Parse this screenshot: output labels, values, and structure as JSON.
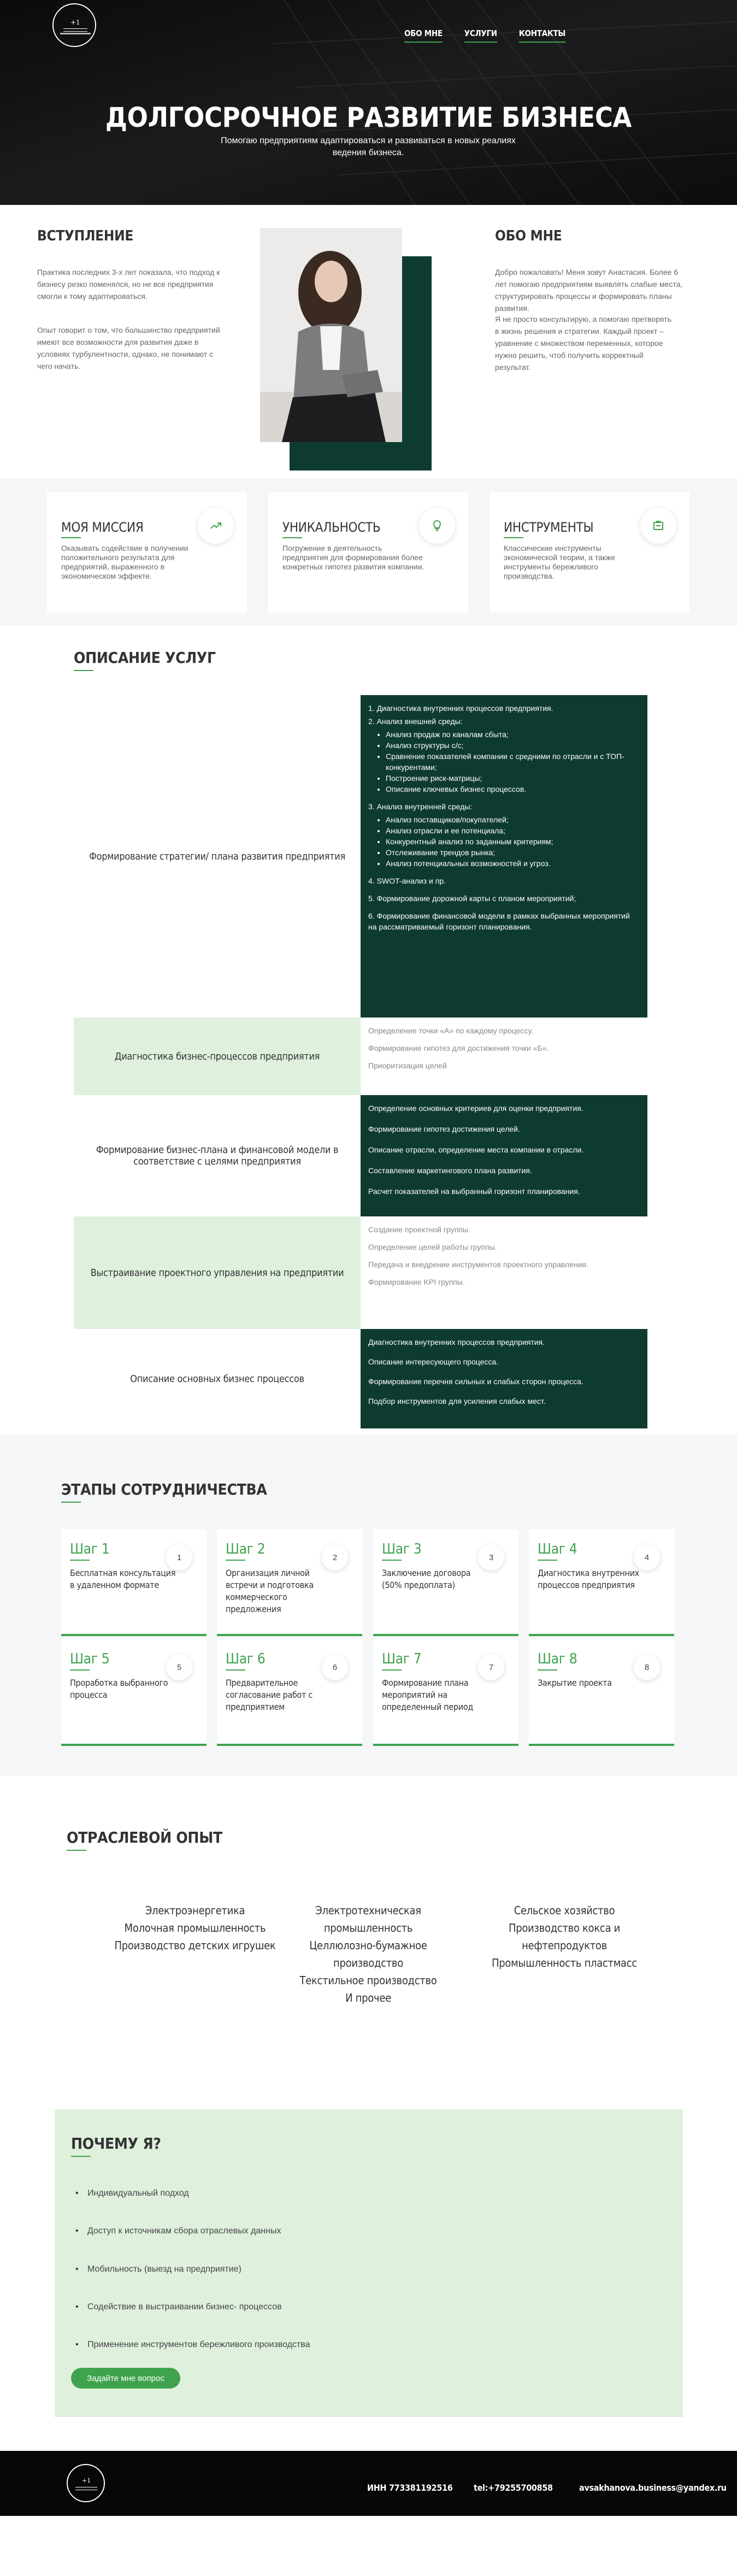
{
  "hero": {
    "title": "ДОЛГОСРОЧНОЕ РАЗВИТИЕ БИЗНЕСА",
    "subtitle": "Помогаю предприятиям адаптироваться и развиваться в новых реалиях ведения бизнеса.",
    "nav": [
      "ОБО МНЕ",
      "УСЛУГИ",
      "КОНТАКТЫ"
    ]
  },
  "intro": {
    "title": "ВСТУПЛЕНИЕ",
    "p1": "Практика последних 3-х лет показала, что подход к бизнесу резко поменялся, но не все предприятия смогли к тому адаптироваться.",
    "p2": "Опыт говорит о том, что большинство предприятий имеют все возможности для развития даже в условиях турбулентности, однако, не понимают с чего начать."
  },
  "about": {
    "title": "ОБО МНЕ",
    "p1": "Добро пожаловать! Меня зовут Анастасия. Более 6 лет помогаю предприятиям выявлять слабые места, структурировать процессы и формировать планы развития.",
    "p2": "Я не просто консультирую, а помогаю претворять в жизнь решения и стратегии. Каждый проект – уравнение с множеством переменных, которое нужно решить, чтоб получить корректный результат."
  },
  "features": [
    {
      "title": "МОЯ МИССИЯ",
      "text": "Оказывать содействие в получении положительного результата для предприятий, выраженного в экономическом эффекте.",
      "icon": "chart-icon"
    },
    {
      "title": "УНИКАЛЬНОСТЬ",
      "text": "Погружение в деятельность предприятия для формирования более конкретных гипотез развития компании.",
      "icon": "bulb-icon"
    },
    {
      "title": "ИНСТРУМЕНТЫ",
      "text": "Классические инструменты экономической теории, а также инструменты бережливого производства.",
      "icon": "tools-icon"
    }
  ],
  "services": {
    "title": "ОПИСАНИЕ УСЛУГ",
    "s1": {
      "name": "Формирование стратегии/ плана развития предприятия",
      "items": [
        "1. Диагностика внутренних процессов предприятия.",
        "2. Анализ внешней среды:",
        "Анализ продаж по каналам сбыта;",
        "Анализ структуры с/с;",
        "Сравнение показателей компании с средними по отрасли и с ТОП-конкурентами;",
        "Построение риск-матрицы;",
        "Описание ключевых бизнес процессов.",
        "3. Анализ внутренней среды:",
        "Анализ поставщиков/покупателей;",
        "Анализ отрасли и ее потенциала;",
        "Конкурентный анализ по заданным критериям;",
        "Отслеживание трендов рынка;",
        "Анализ потенциальных возможностей и угроз.",
        "4. SWOT-анализ и пр.",
        "5. Формирование дорожной карты с планом мероприятий;",
        "6. Формирование финансовой модели в рамках выбранных мероприятий на рассматриваемый горизонт планирования."
      ]
    },
    "s2": {
      "name": "Диагностика бизнес-процессов предприятия",
      "items": [
        "Определение точки «А» по каждому процессу.",
        "Формирование гипотез для достижения точки «Б».",
        "Приоритизация целей"
      ]
    },
    "s3": {
      "name": "Формирование бизнес-плана и финансовой модели в соответствие с целями предприятия",
      "items": [
        "Определение основных критериев для оценки предприятия.",
        "Формирование гипотез достижения целей.",
        "Описание отрасли, определение места компании в отрасли.",
        "Составление маркетингового плана развития.",
        "Расчет показателей на выбранный горизонт планирования."
      ]
    },
    "s4": {
      "name": "Выстраивание проектного управления на предприятии",
      "items": [
        "Создание проектной группы.",
        "Определение целей работы группы.",
        "Передача и внедрение инструментов проектного управления.",
        "Формирование KPI группы."
      ]
    },
    "s5": {
      "name": "Описание основных бизнес процессов",
      "items": [
        "Диагностика внутренних процессов предприятия.",
        "Описание интересующего процесса.",
        "Формирование перечня сильных и слабых сторон процесса.",
        "Подбор инструментов для усиления слабых мест."
      ]
    }
  },
  "stages": {
    "title": "ЭТАПЫ СОТРУДНИЧЕСТВА",
    "steps": [
      {
        "title": "Шаг 1",
        "text": "Бесплатная консультация в удаленном формате",
        "num": "1"
      },
      {
        "title": "Шаг 2",
        "text": "Организация личной встречи и подготовка коммерческого предложения",
        "num": "2"
      },
      {
        "title": "Шаг 3",
        "text": "Заключение договора (50% предоплата)",
        "num": "3"
      },
      {
        "title": "Шаг 4",
        "text": "Диагностика внутренних процессов предприятия",
        "num": "4"
      },
      {
        "title": "Шаг 5",
        "text": "Проработка выбранного процесса",
        "num": "5"
      },
      {
        "title": "Шаг 6",
        "text": "Предварительное согласование работ с предприятием",
        "num": "6"
      },
      {
        "title": "Шаг 7",
        "text": "Формирование плана мероприятий на определенный период",
        "num": "7"
      },
      {
        "title": "Шаг 8",
        "text": "Закрытие проекта",
        "num": "8"
      }
    ]
  },
  "industry": {
    "title": "ОТРАСЛЕВОЙ ОПЫТ",
    "col1": [
      "Электроэнергетика",
      "Молочная промышленность",
      "Производство детских игрушек"
    ],
    "col2": [
      "Электротехническая промышленность",
      "Целлюлозно-бумажное производство",
      "Текстильное производство",
      "И прочее"
    ],
    "col3": [
      "Сельское хозяйство",
      "Производство кокса и нефтепродуктов",
      "Промышленность пластмасс"
    ]
  },
  "why": {
    "title": "ПОЧЕМУ Я?",
    "items": [
      "Индивидуальный подход",
      "Доступ к источникам сбора отраслевых данных",
      "Мобильность (выезд на предприятие)",
      "Содействие в выстраивании бизнес- процессов",
      "Применение инструментов бережливого производства"
    ],
    "button": "Задайте мне вопрос"
  },
  "footer": {
    "inn": "ИНН 773381192516",
    "phone": "tel:+79255700858",
    "email": "avsakhanova.business@yandex.ru"
  }
}
